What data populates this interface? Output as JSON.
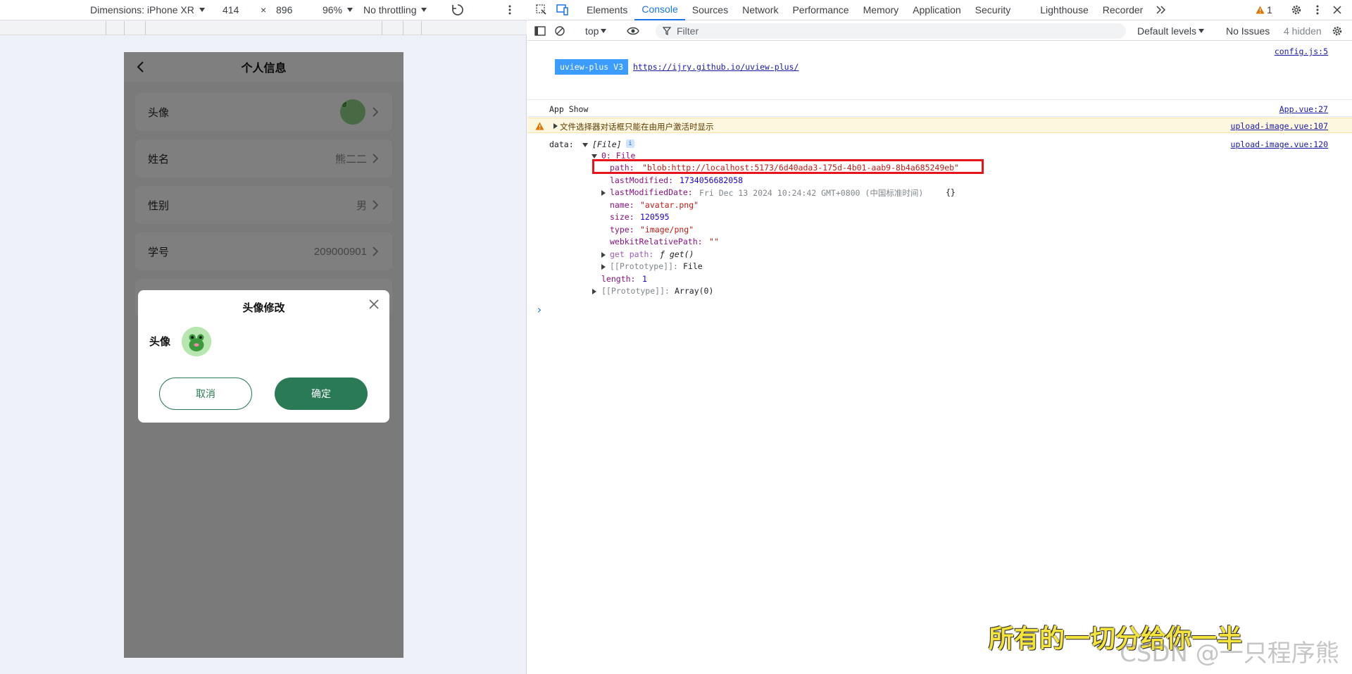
{
  "device_toolbar": {
    "dimensions": "Dimensions: iPhone XR",
    "width": "414",
    "times": "×",
    "height": "896",
    "zoom": "96%",
    "throttling": "No throttling"
  },
  "phone": {
    "title": "个人信息",
    "rows": [
      {
        "label": "头像",
        "value": ""
      },
      {
        "label": "姓名",
        "value": "熊二二"
      },
      {
        "label": "性别",
        "value": "男"
      },
      {
        "label": "学号",
        "value": "209000901"
      }
    ],
    "dialog": {
      "title": "头像修改",
      "avatar_label": "头像",
      "cancel": "取消",
      "confirm": "确定"
    }
  },
  "devtools": {
    "tabs": [
      "Elements",
      "Console",
      "Sources",
      "Network",
      "Performance",
      "Memory",
      "Application",
      "Security",
      "Lighthouse",
      "Recorder"
    ],
    "active_tab": "Console",
    "warning_count": "1",
    "context": "top",
    "filter_placeholder": "Filter",
    "levels": "Default levels",
    "issues": "No Issues",
    "hidden": "4 hidden"
  },
  "console": {
    "badge": "uview-plus V3",
    "badge_link": "https://ijry.github.io/uview-plus/",
    "src1": "config.js:5",
    "app_show": "App Show",
    "src2": "App.vue:27",
    "warning": "文件选择器对话框只能在由用户激活时显示",
    "src3": "upload-image.vue:107",
    "data_label": "data:",
    "data_type": "[File]",
    "src4": "upload-image.vue:120",
    "item0": "0: File",
    "path_key": "path:",
    "path_val": "\"blob:http://localhost:5173/6d40ada3-175d-4b01-aab9-8b4a685249eb\"",
    "lastModified_key": "lastModified:",
    "lastModified_val": "1734056682058",
    "lastModifiedDate_key": "lastModifiedDate:",
    "lastModifiedDate_val": "Fri Dec 13 2024 10:24:42 GMT+0800 (中国标准时间)",
    "lmd_braces": "{}",
    "name_key": "name:",
    "name_val": "\"avatar.png\"",
    "size_key": "size:",
    "size_val": "120595",
    "type_key": "type:",
    "type_val": "\"image/png\"",
    "wrp_key": "webkitRelativePath:",
    "wrp_val": "\"\"",
    "getpath_key": "get path:",
    "getpath_val": "ƒ get()",
    "proto_file_key": "[[Prototype]]:",
    "proto_file_val": "File",
    "length_key": "length:",
    "length_val": "1",
    "proto_arr_key": "[[Prototype]]:",
    "proto_arr_val": "Array(0)",
    "prompt": "›"
  },
  "watermark": {
    "cn": "所有的一切分给你一半",
    "csdn": "CSDN @一只程序熊"
  },
  "colors": {
    "accent": "#1a73e8",
    "brand_green": "#2b7a56",
    "highlight_box": "#e8141b"
  }
}
